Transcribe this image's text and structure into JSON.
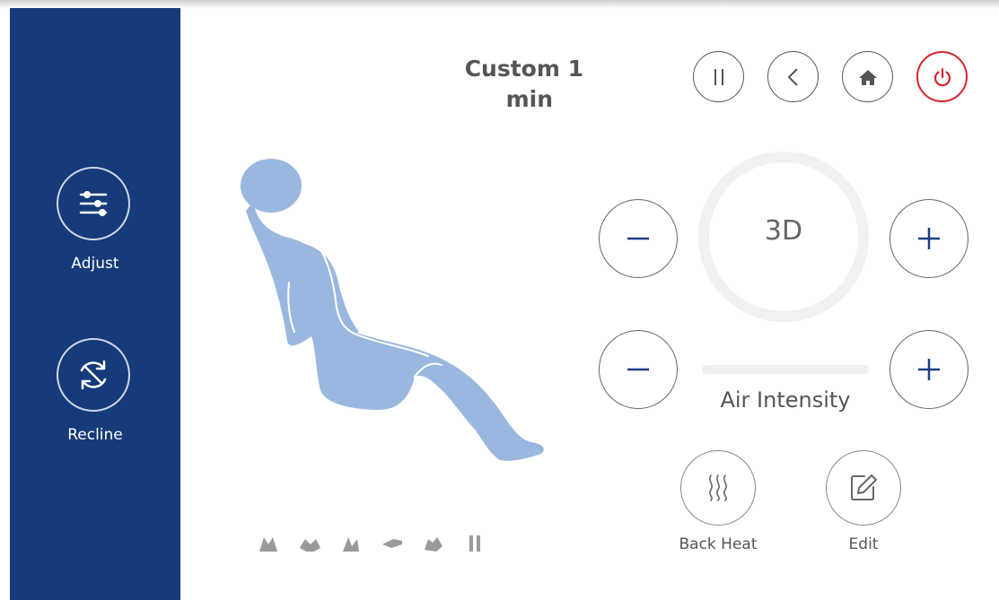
{
  "program": {
    "title_line1": "Custom 1",
    "title_line2": "min"
  },
  "sidebar": {
    "items": [
      {
        "label": "Adjust",
        "icon": "sliders-icon"
      },
      {
        "label": "Recline",
        "icon": "recline-icon"
      }
    ]
  },
  "top_controls": [
    {
      "name": "pause",
      "icon": "pause-icon"
    },
    {
      "name": "back",
      "icon": "chevron-left-icon"
    },
    {
      "name": "home",
      "icon": "home-icon"
    },
    {
      "name": "power",
      "icon": "power-icon"
    }
  ],
  "intensity_3d": {
    "label": "3D"
  },
  "air_intensity": {
    "label": "Air Intensity",
    "level_fraction": 0
  },
  "actions": {
    "back_heat_label": "Back Heat",
    "edit_label": "Edit"
  },
  "colors": {
    "sidebar": "#153b7a",
    "body_figure": "#9ab8df",
    "power": "#d8232a",
    "plus_minus": "#1c3f86"
  }
}
